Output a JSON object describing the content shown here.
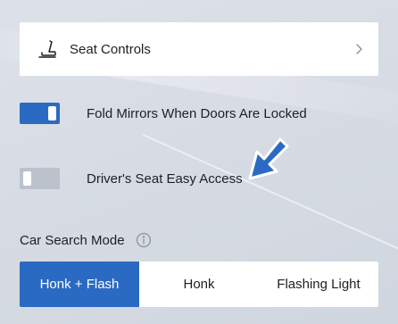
{
  "seat_controls": {
    "label": "Seat Controls",
    "icon": "seat-icon",
    "chevron_icon": "chevron-right-icon"
  },
  "toggles": [
    {
      "label": "Fold Mirrors When Doors Are Locked",
      "on": true
    },
    {
      "label": "Driver's Seat Easy Access",
      "on": false
    }
  ],
  "car_search": {
    "label": "Car Search Mode",
    "info_icon": "info-icon",
    "options": [
      "Honk + Flash",
      "Honk",
      "Flashing Light"
    ],
    "selected": "Honk + Flash"
  },
  "annotation": {
    "icon": "pointer-arrow-icon"
  },
  "colors": {
    "accent": "#2b6ac2",
    "background": "#d7dce4",
    "card": "#ffffff",
    "toggle_off": "#bcc2cc"
  }
}
